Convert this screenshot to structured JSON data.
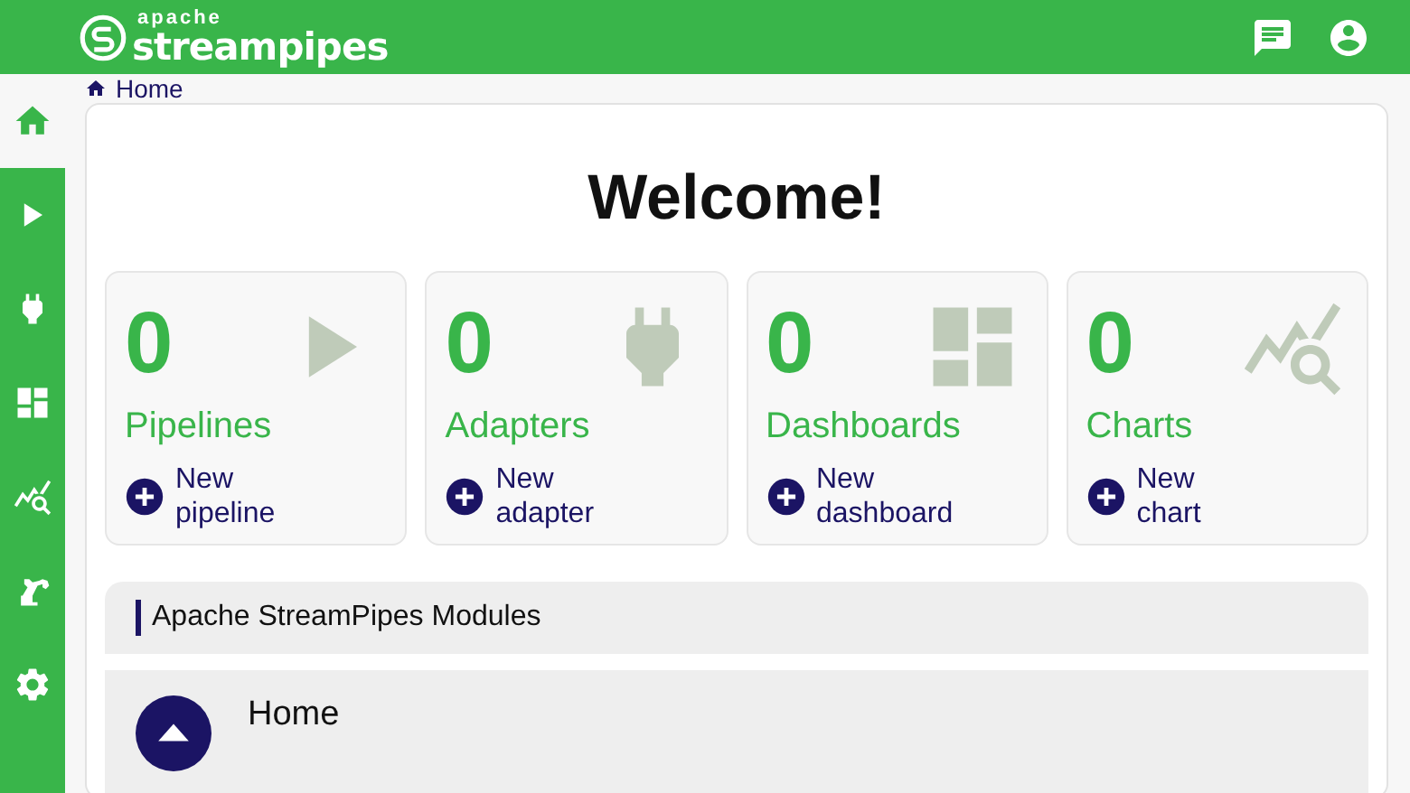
{
  "header": {
    "logo_small": "apache",
    "logo_large": "streampipes"
  },
  "sidebar": {
    "items": [
      {
        "selected": true
      },
      {
        "selected": false
      },
      {
        "selected": false
      },
      {
        "selected": false
      },
      {
        "selected": false
      },
      {
        "selected": false
      },
      {
        "selected": false
      }
    ]
  },
  "breadcrumb": "Home",
  "title": "Welcome!",
  "stats": [
    {
      "count": "0",
      "label": "Pipelines",
      "action": "New pipeline"
    },
    {
      "count": "0",
      "label": "Adapters",
      "action": "New adapter"
    },
    {
      "count": "0",
      "label": "Dashboards",
      "action": "New dashboard"
    },
    {
      "count": "0",
      "label": "Charts",
      "action": "New chart"
    }
  ],
  "modules": {
    "title": "Apache StreamPipes Modules",
    "items": [
      {
        "label": "Home"
      }
    ]
  }
}
